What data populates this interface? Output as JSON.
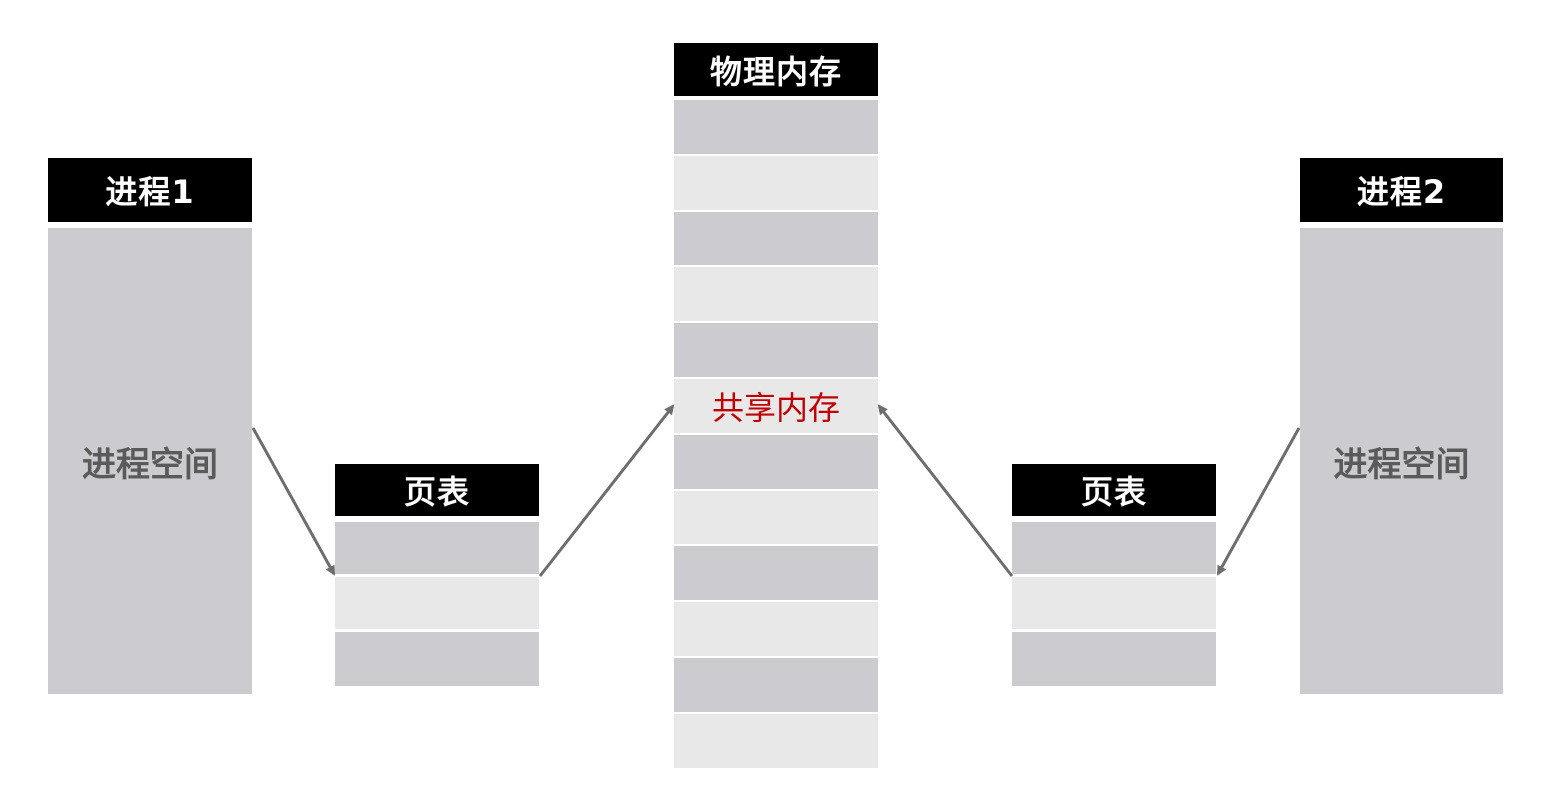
{
  "process1": {
    "title": "进程1",
    "space_label": "进程空间"
  },
  "process2": {
    "title": "进程2",
    "space_label": "进程空间"
  },
  "page_table_left": {
    "title": "页表",
    "rows": 3
  },
  "page_table_right": {
    "title": "页表",
    "rows": 3
  },
  "physical_memory": {
    "title": "物理内存",
    "rows": 12,
    "shared_row_index": 5,
    "shared_label": "共享内存"
  },
  "colors": {
    "header_bg": "#000000",
    "header_text": "#ffffff",
    "cell_dark": "#cccbcf",
    "cell_light": "#e8e8e8",
    "shared_text": "#c00000",
    "arrow": "#6d6d6d"
  }
}
